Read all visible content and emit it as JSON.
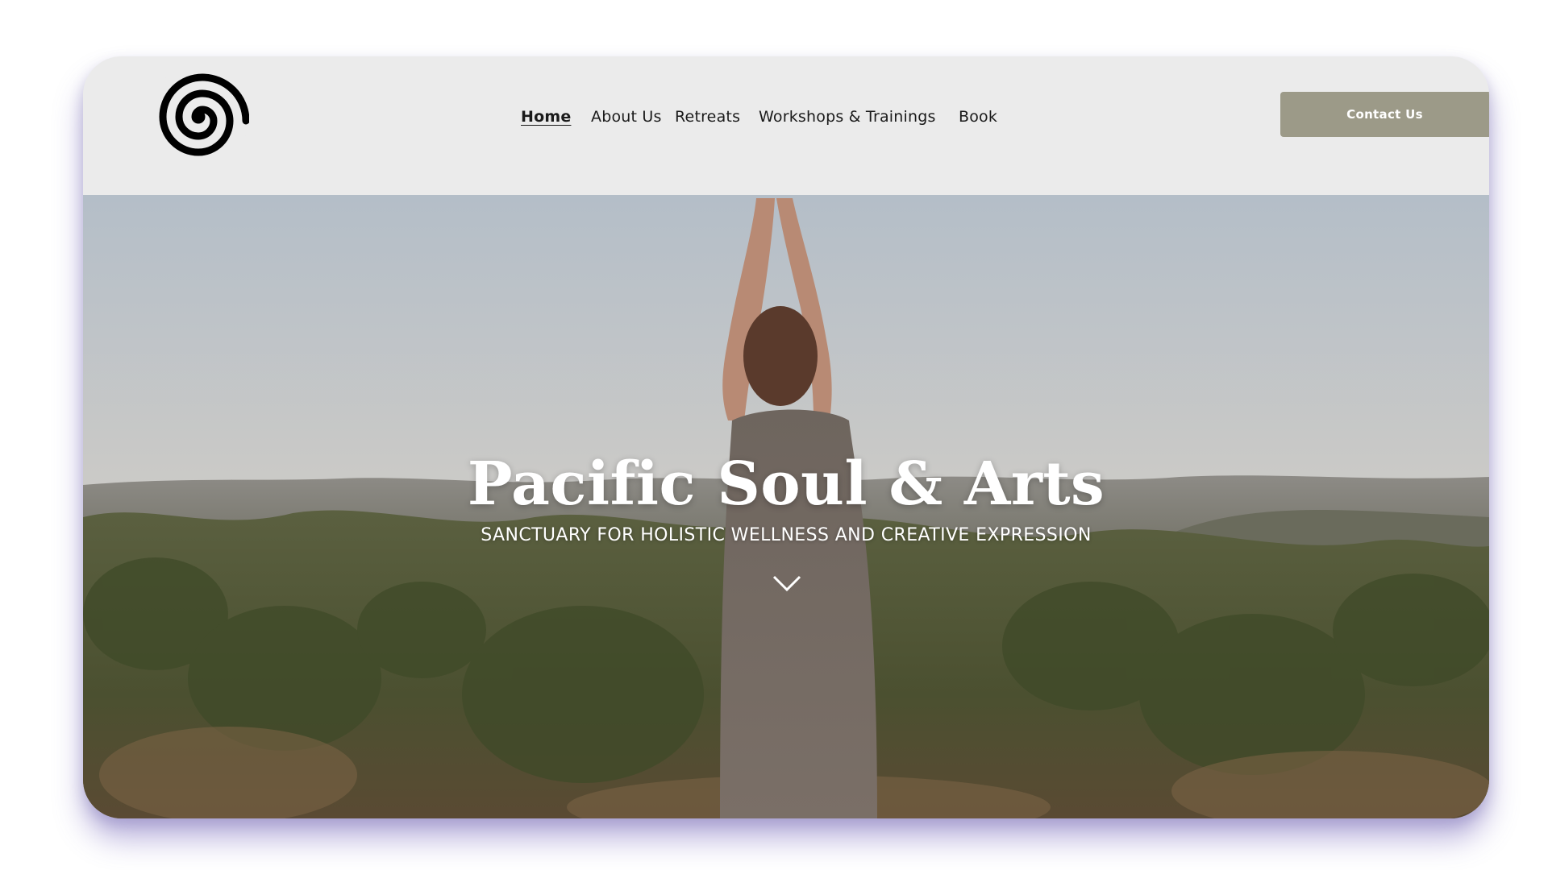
{
  "brand": {
    "logo_icon": "spiral-logo-icon"
  },
  "nav": {
    "items": [
      {
        "label": "Home",
        "active": true
      },
      {
        "label": "About Us",
        "active": false
      },
      {
        "label": "Retreats",
        "active": false
      },
      {
        "label": "Workshops & Trainings",
        "active": false
      },
      {
        "label": "Book",
        "active": false
      }
    ],
    "contact_label": "Contact Us"
  },
  "hero": {
    "title": "Pacific Soul & Arts",
    "subtitle": "SANCTUARY FOR HOLISTIC WELLNESS AND CREATIVE EXPRESSION",
    "scroll_icon": "chevron-down-icon"
  },
  "colors": {
    "header_bg": "#ebebeb",
    "button_bg": "#9c9a88",
    "frame_shadow": "#6e5fb9",
    "text_dark": "#1a1a1a"
  }
}
